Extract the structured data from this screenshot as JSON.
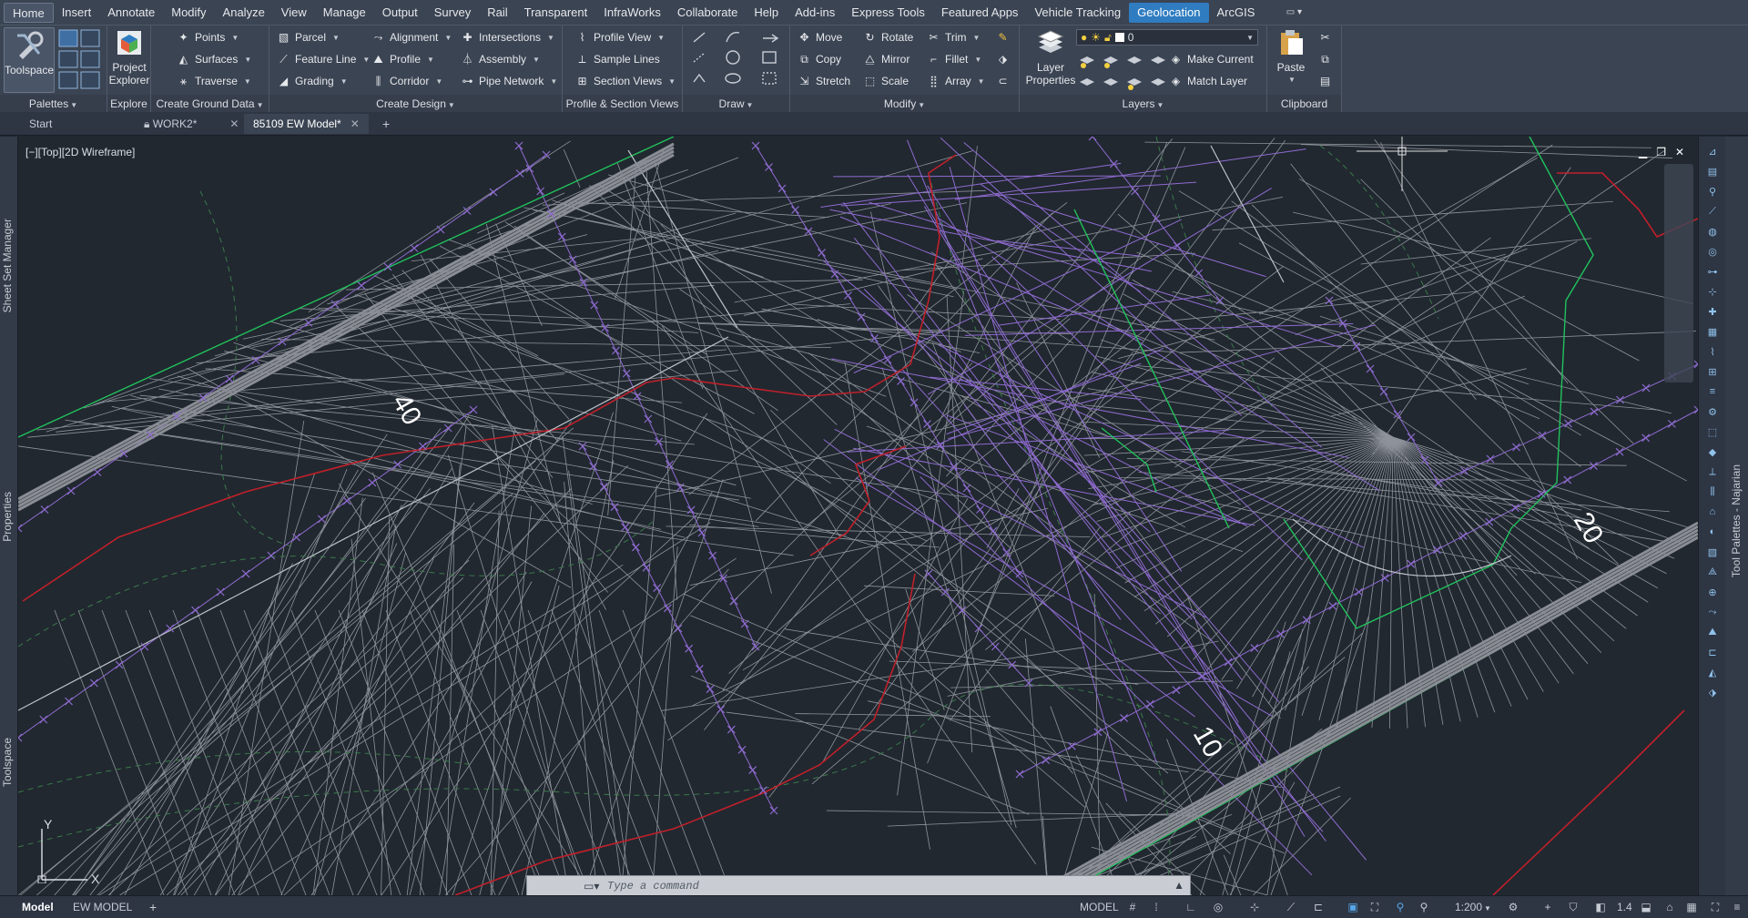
{
  "menu_tabs": [
    "Home",
    "Insert",
    "Annotate",
    "Modify",
    "Analyze",
    "View",
    "Manage",
    "Output",
    "Survey",
    "Rail",
    "Transparent",
    "InfraWorks",
    "Collaborate",
    "Help",
    "Add-ins",
    "Express Tools",
    "Featured Apps",
    "Vehicle Tracking",
    "Geolocation",
    "ArcGIS"
  ],
  "ribbon": {
    "toolspace": "Toolspace",
    "project_explorer_1": "Project",
    "project_explorer_2": "Explorer",
    "palettes": "Palettes",
    "explore": "Explore",
    "ground": {
      "points": "Points",
      "surfaces": "Surfaces",
      "traverse": "Traverse",
      "title": "Create Ground Data"
    },
    "design": {
      "parcel": "Parcel",
      "feature_line": "Feature Line",
      "grading": "Grading",
      "alignment": "Alignment",
      "profile": "Profile",
      "corridor": "Corridor",
      "intersections": "Intersections",
      "assembly": "Assembly",
      "pipe_network": "Pipe Network",
      "title": "Create Design"
    },
    "psv": {
      "profile_view": "Profile View",
      "sample_lines": "Sample Lines",
      "section_views": "Section Views",
      "title": "Profile & Section Views"
    },
    "draw": {
      "title": "Draw"
    },
    "modify": {
      "move": "Move",
      "copy": "Copy",
      "stretch": "Stretch",
      "rotate": "Rotate",
      "mirror": "Mirror",
      "scale": "Scale",
      "trim": "Trim",
      "fillet": "Fillet",
      "array": "Array",
      "title": "Modify"
    },
    "layers": {
      "layer_properties_1": "Layer",
      "layer_properties_2": "Properties",
      "current_layer": "0",
      "make_current": "Make Current",
      "match_layer": "Match Layer",
      "title": "Layers"
    },
    "clipboard": {
      "paste": "Paste",
      "title": "Clipboard"
    }
  },
  "doc_tabs": {
    "start": "Start",
    "work2": "WORK2*",
    "active": "85109 EW Model*"
  },
  "viewport": {
    "label": "[−][Top][2D Wireframe]",
    "station_labels": [
      "40",
      "20",
      "10"
    ],
    "ucs_y": "Y",
    "ucs_x": "X"
  },
  "side_palettes": {
    "sheet_set": "Sheet Set Manager",
    "properties": "Properties",
    "toolspace": "Toolspace",
    "tool_palettes": "Tool Palettes - Najarian"
  },
  "command": {
    "placeholder": "Type a command"
  },
  "status": {
    "model_tab": "Model",
    "layout_tab": "EW MODEL",
    "model_label": "MODEL",
    "scale": "1:200",
    "lineweight": "1.4"
  },
  "colors": {
    "accent": "#2f7cc0",
    "canvas": "#212830",
    "ribbon": "#3b4453",
    "tin_lines": "#9a9ea6",
    "feature_purple": "#9b59d6",
    "boundary_red": "#c0202a",
    "green_line": "#21c25c"
  }
}
